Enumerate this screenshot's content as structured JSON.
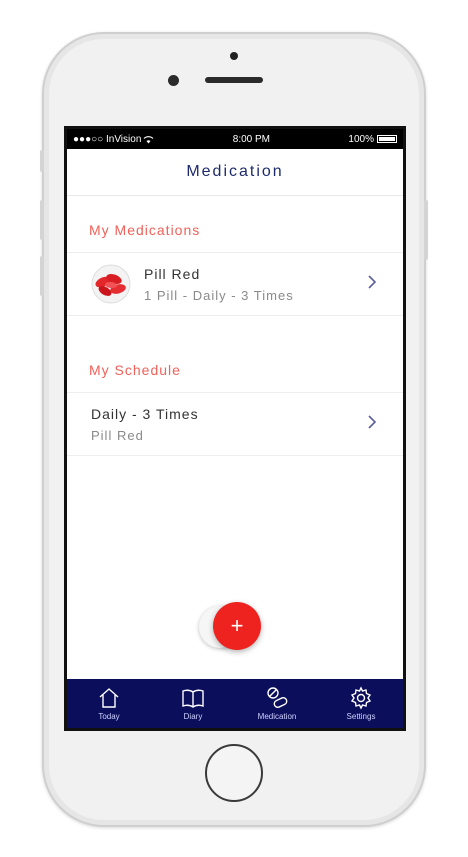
{
  "status_bar": {
    "carrier": "●●●○○ InVision",
    "time": "8:00 PM",
    "battery": "100%"
  },
  "header": {
    "title": "Medication"
  },
  "medications": {
    "section_title": "My Medications",
    "items": [
      {
        "name": "Pill Red",
        "details": "1 Pill - Daily - 3 Times"
      }
    ]
  },
  "schedule": {
    "section_title": "My Schedule",
    "items": [
      {
        "title": "Daily - 3 Times",
        "medication": "Pill Red"
      }
    ]
  },
  "fab": {
    "label": "+"
  },
  "tabs": [
    {
      "label": "Today",
      "icon": "house-icon"
    },
    {
      "label": "Diary",
      "icon": "book-icon"
    },
    {
      "label": "Medication",
      "icon": "pills-icon"
    },
    {
      "label": "Settings",
      "icon": "gear-icon"
    }
  ],
  "colors": {
    "accent": "#f0615a",
    "nav": "#0b0e5a",
    "fab": "#ee2320",
    "title": "#1e2b6b"
  }
}
